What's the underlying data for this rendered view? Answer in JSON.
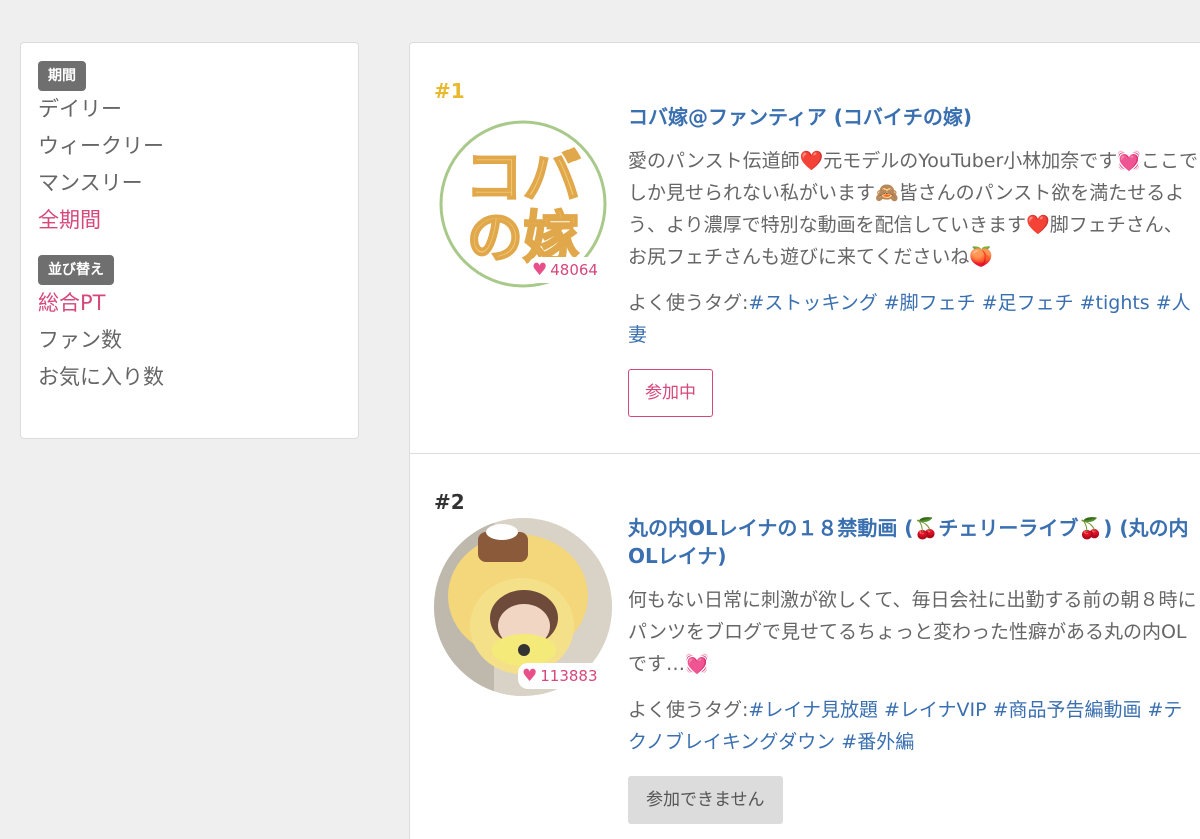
{
  "sidebar": {
    "period_badge": "期間",
    "period_items": [
      "デイリー",
      "ウィークリー",
      "マンスリー",
      "全期間"
    ],
    "sort_badge": "並び替え",
    "sort_items": [
      "総合PT",
      "ファン数",
      "お気に入り数"
    ]
  },
  "cards": [
    {
      "rank": "#1",
      "logo_text_top": "コバ",
      "logo_text_bottom": "の嫁",
      "fav_count": "48064",
      "title": "コバ嫁@ファンティア (コバイチの嫁)",
      "description": "愛のパンスト伝道師❤️元モデルのYouTuber小林加奈です💓ここでしか見せられない私がいます🙈皆さんのパンスト欲を満たせるよう、より濃厚で特別な動画を配信していきます❤️脚フェチさん、お尻フェチさんも遊びに来てくださいね🍑",
      "tags_label": "よく使うタグ:",
      "tags": [
        "#ストッキング",
        "#脚フェチ",
        "#足フェチ",
        "#tights",
        "#人妻"
      ],
      "button": "参加中"
    },
    {
      "rank": "#2",
      "fav_count": "113883",
      "title": "丸の内OLレイナの１８禁動画 (🍒チェリーライブ🍒) (丸の内OLレイナ)",
      "description": "何もない日常に刺激が欲しくて、毎日会社に出勤する前の朝８時にパンツをブログで見せてるちょっと変わった性癖がある丸の内OLです…💓",
      "tags_label": "よく使うタグ:",
      "tags": [
        "#レイナ見放題",
        "#レイナVIP",
        "#商品予告編動画",
        "#テクノブレイキングダウン",
        "#番外編"
      ],
      "button": "参加できません"
    }
  ],
  "colors": {
    "accent": "#d6477a",
    "link": "#3a6fb0",
    "rank1": "#e8b92f"
  }
}
